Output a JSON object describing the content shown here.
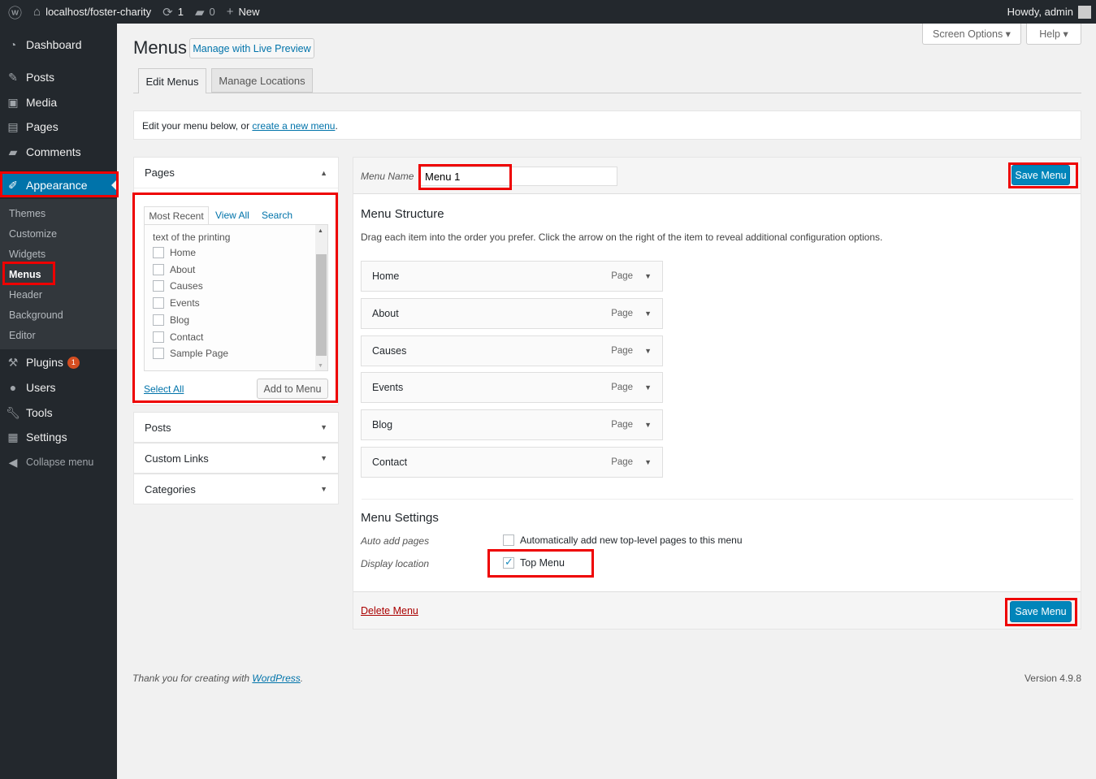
{
  "adminbar": {
    "site": "localhost/foster-charity",
    "updates": "1",
    "comments": "0",
    "new": "New",
    "howdy": "Howdy, admin"
  },
  "sidebar": {
    "items": [
      "Dashboard",
      "Posts",
      "Media",
      "Pages",
      "Comments",
      "Appearance",
      "Plugins",
      "Users",
      "Tools",
      "Settings",
      "Collapse menu"
    ],
    "plugins_badge": "1",
    "submenu": [
      "Themes",
      "Customize",
      "Widgets",
      "Menus",
      "Header",
      "Background",
      "Editor"
    ]
  },
  "header": {
    "title": "Menus",
    "live_preview": "Manage with Live Preview",
    "screen_options": "Screen Options",
    "help": "Help"
  },
  "tabs": [
    "Edit Menus",
    "Manage Locations"
  ],
  "notice": {
    "text": "Edit your menu below, or ",
    "link": "create a new menu",
    "end": "."
  },
  "pages_box": {
    "title": "Pages",
    "tabs": [
      "Most Recent",
      "View All",
      "Search"
    ],
    "truncated": "text of the printing",
    "items": [
      "Home",
      "About",
      "Causes",
      "Events",
      "Blog",
      "Contact",
      "Sample Page"
    ],
    "select_all": "Select All",
    "add": "Add to Menu"
  },
  "accordions": [
    "Posts",
    "Custom Links",
    "Categories"
  ],
  "menu": {
    "name_label": "Menu Name",
    "name_value": "Menu 1",
    "save": "Save Menu",
    "structure_title": "Menu Structure",
    "structure_desc": "Drag each item into the order you prefer. Click the arrow on the right of the item to reveal additional configuration options.",
    "items": [
      {
        "title": "Home",
        "type": "Page"
      },
      {
        "title": "About",
        "type": "Page"
      },
      {
        "title": "Causes",
        "type": "Page"
      },
      {
        "title": "Events",
        "type": "Page"
      },
      {
        "title": "Blog",
        "type": "Page"
      },
      {
        "title": "Contact",
        "type": "Page"
      }
    ],
    "settings_title": "Menu Settings",
    "auto_add_label": "Auto add pages",
    "auto_add_text": "Automatically add new top-level pages to this menu",
    "auto_add_checked": false,
    "display_label": "Display location",
    "top_menu": "Top Menu",
    "top_menu_checked": true,
    "delete": "Delete Menu"
  },
  "footer": {
    "thanks": "Thank you for creating with ",
    "wp": "WordPress",
    "dot": ".",
    "version": "Version 4.9.8"
  }
}
